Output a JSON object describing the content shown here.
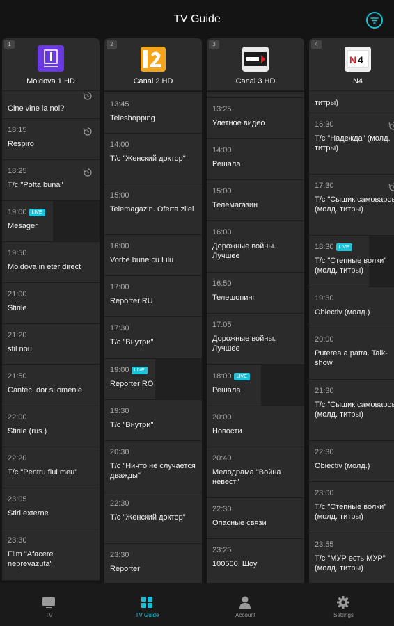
{
  "header": {
    "title": "TV Guide"
  },
  "channels": [
    {
      "num": "1",
      "name": "Moldova 1 HD",
      "logo": "moldova1-logo",
      "programs": [
        {
          "time": "",
          "name": "Cine vine la noi?",
          "replay": true
        },
        {
          "time": "18:15",
          "name": "Respiro",
          "replay": true
        },
        {
          "time": "18:25",
          "name": "T/c \"Pofta buna\"",
          "replay": true
        },
        {
          "time": "19:00",
          "name": "Mesager",
          "live": true
        },
        {
          "time": "19:50",
          "name": "Moldova in eter direct"
        },
        {
          "time": "21:00",
          "name": "Stirile"
        },
        {
          "time": "21:20",
          "name": "stil nou"
        },
        {
          "time": "21:50",
          "name": "Cantec, dor si omenie"
        },
        {
          "time": "22:00",
          "name": "Stirile (rus.)"
        },
        {
          "time": "22:20",
          "name": "T/c \"Pentru fiul meu\""
        },
        {
          "time": "23:05",
          "name": "Stiri externe"
        },
        {
          "time": "23:30",
          "name": "Film \"Afacere neprevazuta\""
        }
      ]
    },
    {
      "num": "2",
      "name": "Canal 2 HD",
      "logo": "canal2-logo",
      "programs": [
        {
          "time": "13:45",
          "name": "Teleshopping"
        },
        {
          "time": "14:00",
          "name": "T/c \"Женский доктор\""
        },
        {
          "time": "15:00",
          "name": "Telemagazin. Oferta zilei"
        },
        {
          "time": "16:00",
          "name": "Vorbe bune cu Lilu"
        },
        {
          "time": "17:00",
          "name": "Reporter RU"
        },
        {
          "time": "17:30",
          "name": "T/c \"Внутри\""
        },
        {
          "time": "19:00",
          "name": "Reporter RO",
          "live": true
        },
        {
          "time": "19:30",
          "name": "T/c \"Внутри\""
        },
        {
          "time": "20:30",
          "name": "T/c \"Ничто не случается дважды\""
        },
        {
          "time": "22:30",
          "name": "T/c \"Женский доктор\""
        },
        {
          "time": "23:30",
          "name": "Reporter"
        }
      ]
    },
    {
      "num": "3",
      "name": "Canal 3 HD",
      "logo": "canal3-logo",
      "programs": [
        {
          "time": "13:25",
          "name": "Улетное видео"
        },
        {
          "time": "14:00",
          "name": "Решала"
        },
        {
          "time": "15:00",
          "name": "Телемагазин"
        },
        {
          "time": "16:00",
          "name": "Дорожные войны. Лучшее"
        },
        {
          "time": "16:50",
          "name": "Телешопинг"
        },
        {
          "time": "17:05",
          "name": "Дорожные войны. Лучшее"
        },
        {
          "time": "18:00",
          "name": "Решала",
          "live": true
        },
        {
          "time": "20:00",
          "name": "Новости"
        },
        {
          "time": "20:40",
          "name": "Мелодрама \"Война невест\""
        },
        {
          "time": "22:30",
          "name": "Опасные связи"
        },
        {
          "time": "23:25",
          "name": "100500. Шоу"
        }
      ]
    },
    {
      "num": "4",
      "name": "N4",
      "logo": "n4-logo",
      "programs": [
        {
          "time": "",
          "name": "титры)"
        },
        {
          "time": "16:30",
          "name": "Т/с \"Надежда\" (молд. титры)",
          "replay": true
        },
        {
          "time": "17:30",
          "name": "Т/с \"Сыщик самоваров\" (молд. титры)",
          "replay": true
        },
        {
          "time": "18:30",
          "name": "Т/с \"Степные волки\" (молд. титры)",
          "live": true
        },
        {
          "time": "19:30",
          "name": "Obiectiv (молд.)"
        },
        {
          "time": "20:00",
          "name": "Puterea a patra. Talk-show"
        },
        {
          "time": "21:30",
          "name": "Т/с \"Сыщик самоваров\" (молд. титры)"
        },
        {
          "time": "22:30",
          "name": "Obiectiv (молд.)"
        },
        {
          "time": "23:00",
          "name": "Т/с \"Степные волки\" (молд. титры)"
        },
        {
          "time": "23:55",
          "name": "Т/с \"МУР есть МУР\" (молд. титры)"
        }
      ]
    }
  ],
  "live_label": "LIVE",
  "nav": [
    {
      "label": "TV",
      "icon": "tv-icon"
    },
    {
      "label": "TV Guide",
      "icon": "tv-guide-icon",
      "active": true
    },
    {
      "label": "Account",
      "icon": "account-icon"
    },
    {
      "label": "Settings",
      "icon": "settings-icon"
    }
  ],
  "colors": {
    "accent": "#19c1d6",
    "background": "#141414",
    "card": "#2b2b2b"
  }
}
